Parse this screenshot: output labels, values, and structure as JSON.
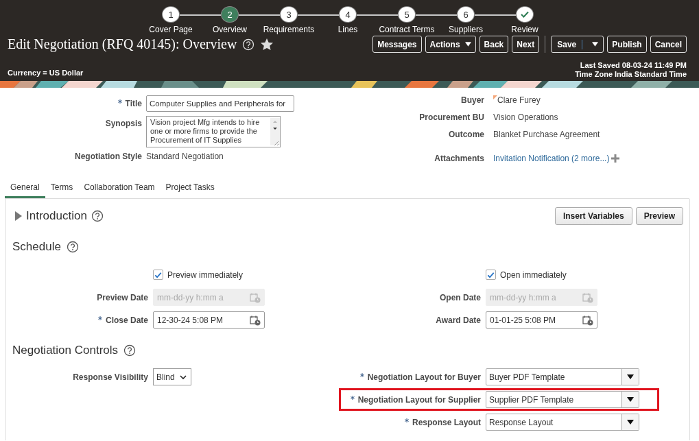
{
  "steps": [
    {
      "number": "1",
      "label": "Cover Page",
      "selected": false,
      "kind": "number"
    },
    {
      "number": "2",
      "label": "Overview",
      "selected": true,
      "kind": "number"
    },
    {
      "number": "3",
      "label": "Requirements",
      "selected": false,
      "kind": "number"
    },
    {
      "number": "4",
      "label": "Lines",
      "selected": false,
      "kind": "number"
    },
    {
      "number": "5",
      "label": "Contract Terms",
      "selected": false,
      "kind": "number"
    },
    {
      "number": "6",
      "label": "Suppliers",
      "selected": false,
      "kind": "number"
    },
    {
      "label": "Review",
      "selected": false,
      "kind": "check"
    }
  ],
  "header": {
    "title": "Edit Negotiation (RFQ 40145): Overview",
    "currency": "Currency = US Dollar",
    "last_saved": "Last Saved 08-03-24 11:49 PM",
    "time_zone": "Time Zone India Standard Time",
    "buttons": [
      {
        "label": "Messages",
        "kind": "button",
        "separated": false
      },
      {
        "label": "Actions",
        "kind": "menu",
        "separated": false
      },
      {
        "label": "Back",
        "kind": "button",
        "separated": false
      },
      {
        "label": "Next",
        "kind": "button",
        "separated": false
      },
      {
        "label": "Save",
        "kind": "split",
        "separated": true
      },
      {
        "label": "Publish",
        "kind": "button",
        "separated": false
      },
      {
        "label": "Cancel",
        "kind": "button",
        "separated": false
      }
    ]
  },
  "summary_left": [
    {
      "label": "Title",
      "kind": "input",
      "required": true,
      "value": "Computer Supplies and Peripherals for"
    },
    {
      "label": "Synopsis",
      "kind": "textarea",
      "required": false,
      "value": "Vision project Mfg intends to hire one or more firms to provide the Procurement of IT Supplies"
    },
    {
      "label": "Negotiation Style",
      "kind": "text",
      "required": false,
      "value": "Standard Negotiation"
    }
  ],
  "summary_right": [
    {
      "label": "Buyer",
      "kind": "person",
      "value": "Clare Furey"
    },
    {
      "label": "Procurement BU",
      "kind": "text",
      "value": "Vision Operations"
    },
    {
      "label": "Outcome",
      "kind": "text",
      "value": "Blanket Purchase Agreement"
    },
    {
      "label": "Attachments",
      "kind": "link",
      "value": "Invitation Notification (2 more...)"
    }
  ],
  "tabs": [
    {
      "label": "General",
      "selected": true
    },
    {
      "label": "Terms",
      "selected": false
    },
    {
      "label": "Collaboration Team",
      "selected": false
    },
    {
      "label": "Project Tasks",
      "selected": false
    }
  ],
  "introduction": {
    "title": "Introduction",
    "expanded": false,
    "buttons": [
      "Insert Variables",
      "Preview"
    ]
  },
  "schedule": {
    "title": "Schedule",
    "left": [
      {
        "kind": "checkbox",
        "label": "Preview immediately",
        "checked": true
      },
      {
        "kind": "date",
        "label": "Preview Date",
        "required": false,
        "disabled": true,
        "placeholder": "mm-dd-yy h:mm a"
      },
      {
        "kind": "date",
        "label": "Close Date",
        "required": true,
        "disabled": false,
        "value": "12-30-24 5:08 PM"
      }
    ],
    "right": [
      {
        "kind": "checkbox",
        "label": "Open immediately",
        "checked": true
      },
      {
        "kind": "date",
        "label": "Open Date",
        "required": false,
        "disabled": true,
        "placeholder": "mm-dd-yy h:mm a"
      },
      {
        "kind": "date",
        "label": "Award Date",
        "required": false,
        "disabled": false,
        "value": "01-01-25 5:08 PM"
      }
    ]
  },
  "controls": {
    "title": "Negotiation Controls",
    "left": [
      {
        "kind": "choice",
        "label": "Response Visibility",
        "required": false,
        "value": "Blind",
        "highlighted": false
      }
    ],
    "right": [
      {
        "kind": "combo",
        "label": "Negotiation Layout for Buyer",
        "required": true,
        "value": "Buyer PDF Template",
        "highlighted": false
      },
      {
        "kind": "combo",
        "label": "Negotiation Layout for Supplier",
        "required": true,
        "value": "Supplier PDF Template",
        "highlighted": true
      },
      {
        "kind": "combo",
        "label": "Response Layout",
        "required": true,
        "value": "Response Layout",
        "highlighted": false
      }
    ]
  }
}
